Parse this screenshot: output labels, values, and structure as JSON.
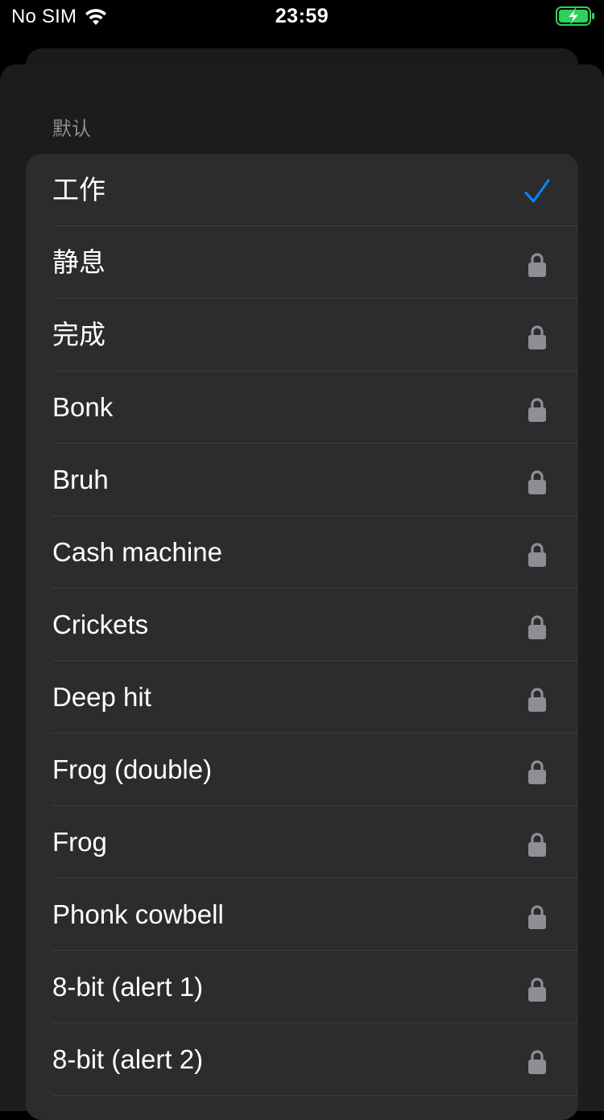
{
  "status_bar": {
    "carrier": "No SIM",
    "time": "23:59",
    "wifi_icon": "wifi-icon",
    "battery_icon": "battery-charging-icon",
    "battery_color": "#30d158"
  },
  "section": {
    "header": "默认"
  },
  "sounds": [
    {
      "label": "工作",
      "icon": "checkmark-icon"
    },
    {
      "label": "静息",
      "icon": "lock-icon"
    },
    {
      "label": "完成",
      "icon": "lock-icon"
    },
    {
      "label": "Bonk",
      "icon": "lock-icon"
    },
    {
      "label": "Bruh",
      "icon": "lock-icon"
    },
    {
      "label": "Cash machine",
      "icon": "lock-icon"
    },
    {
      "label": "Crickets",
      "icon": "lock-icon"
    },
    {
      "label": "Deep hit",
      "icon": "lock-icon"
    },
    {
      "label": "Frog (double)",
      "icon": "lock-icon"
    },
    {
      "label": "Frog",
      "icon": "lock-icon"
    },
    {
      "label": "Phonk cowbell",
      "icon": "lock-icon"
    },
    {
      "label": "8-bit (alert 1)",
      "icon": "lock-icon"
    },
    {
      "label": "8-bit (alert 2)",
      "icon": "lock-icon"
    }
  ],
  "colors": {
    "accent": "#0a84ff",
    "lock": "#8e8e93",
    "cell_background": "#2c2c2e",
    "sheet_background": "#1c1c1e"
  }
}
